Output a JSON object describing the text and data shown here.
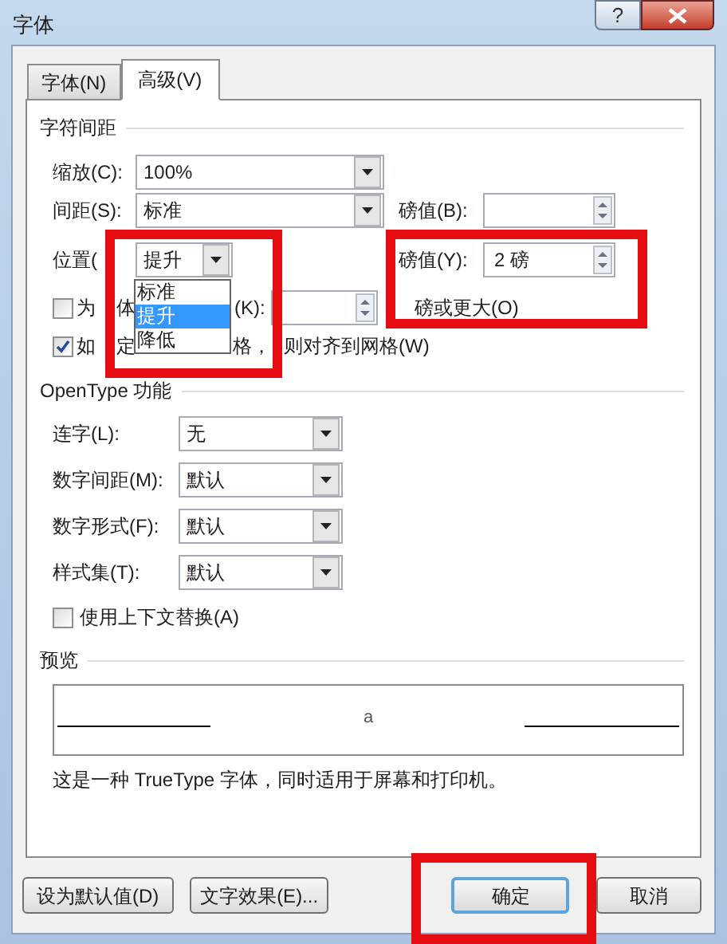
{
  "window": {
    "title": "字体",
    "help_button": "?"
  },
  "tabs": [
    {
      "label": "字体(N)",
      "selected": false
    },
    {
      "label": "高级(V)",
      "selected": true
    }
  ],
  "character_spacing": {
    "heading": "字符间距",
    "scale": {
      "label": "缩放(C):",
      "value": "100%"
    },
    "spacing": {
      "label": "间距(S):",
      "value": "标准",
      "points_label": "磅值(B):"
    },
    "position": {
      "label": "位置(",
      "value": "提升",
      "points_label": "磅值(Y):",
      "points_value": "2 磅",
      "options": [
        {
          "label": "标准",
          "selected": false
        },
        {
          "label": "提升",
          "selected": true
        },
        {
          "label": "降低",
          "selected": false
        }
      ]
    },
    "kerning": {
      "checked": false,
      "label_start": "为",
      "label_middle": "体",
      "label_end": "(K):",
      "suffix": "磅或更大(O)"
    },
    "grid": {
      "checked": true,
      "label_start": "如",
      "label_middle": "定",
      "label_end": "格，",
      "label_tail": "则对齐到网格(W)"
    }
  },
  "opentype": {
    "heading": "OpenType 功能",
    "rows": [
      {
        "label": "连字(L):",
        "value": "无"
      },
      {
        "label": "数字间距(M):",
        "value": "默认"
      },
      {
        "label": "数字形式(F):",
        "value": "默认"
      },
      {
        "label": "样式集(T):",
        "value": "默认"
      }
    ],
    "contextual": {
      "checked": false,
      "label": "使用上下文替换(A)"
    }
  },
  "preview": {
    "heading": "预览",
    "sample": "a",
    "description": "这是一种 TrueType 字体，同时适用于屏幕和打印机。"
  },
  "buttons": [
    {
      "label": "设为默认值(D)",
      "kind": "secondary"
    },
    {
      "label": "文字效果(E)...",
      "kind": "secondary"
    },
    {
      "label": "确定",
      "kind": "default"
    },
    {
      "label": "取消",
      "kind": "secondary"
    }
  ]
}
